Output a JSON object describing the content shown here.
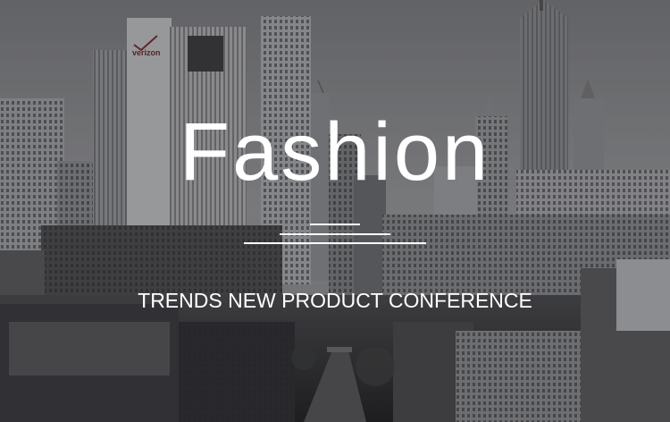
{
  "banner": {
    "title": "Fashion",
    "subtitle": "TRENDS NEW PRODUCT CONFERENCE"
  },
  "background": {
    "scene": "city-skyline-photo",
    "tone": "grayscale",
    "sign_text": "verizon"
  },
  "colors": {
    "text": "#ffffff",
    "sky": "#8f9092",
    "overlay": "#1e1e22"
  }
}
